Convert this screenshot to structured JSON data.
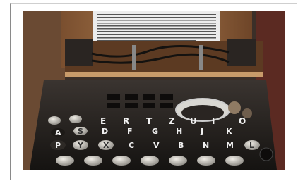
{
  "photo": {
    "subject": "enigma-machine",
    "lamp_row_letters": [
      "E",
      "R",
      "T",
      "Z",
      "U",
      "I",
      "O"
    ],
    "key_row_letters": [
      "A",
      "S",
      "D",
      "F",
      "G",
      "H",
      "J",
      "K"
    ],
    "bottom_row_letters": [
      "P",
      "Y",
      "X",
      "C",
      "V",
      "B",
      "N",
      "M",
      "L"
    ],
    "colors": {
      "wood": "#9a6a42",
      "panel": "#1d1a18",
      "paper": "#ececec",
      "key_cap": "#d8d4cc"
    }
  }
}
